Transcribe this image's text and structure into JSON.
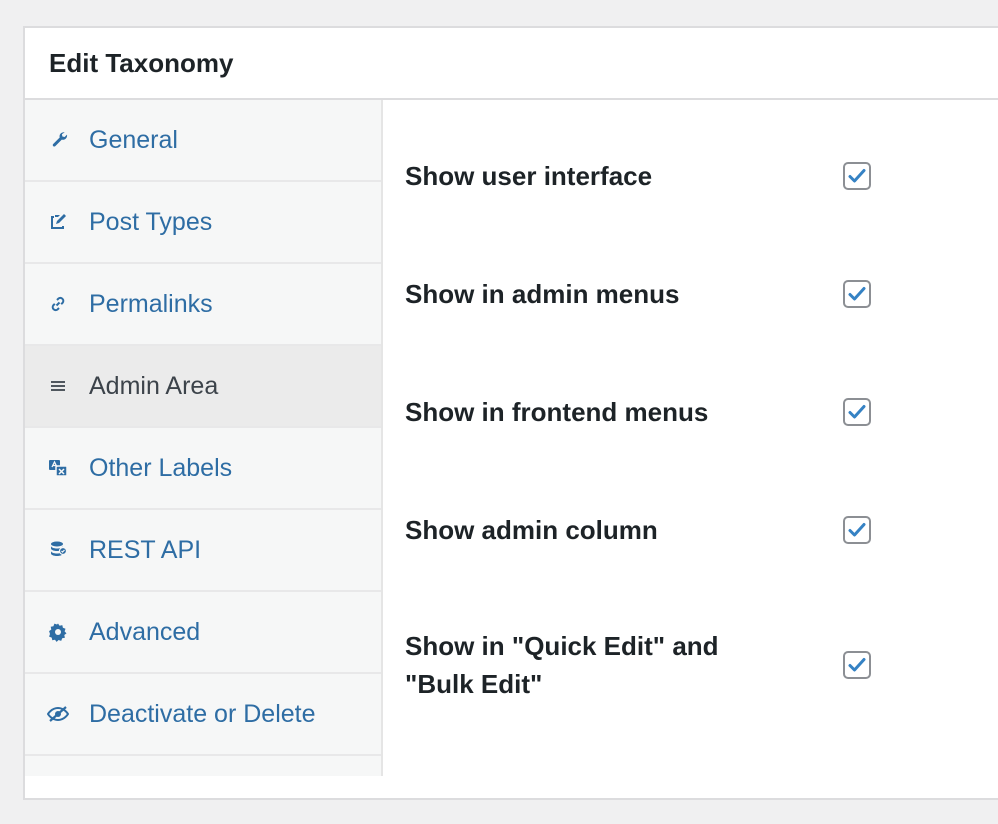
{
  "panel": {
    "title": "Edit Taxonomy"
  },
  "sidebar": {
    "items": [
      {
        "label": "General",
        "icon": "wrench-icon",
        "active": false
      },
      {
        "label": "Post Types",
        "icon": "edit-page-icon",
        "active": false
      },
      {
        "label": "Permalinks",
        "icon": "link-icon",
        "active": false
      },
      {
        "label": "Admin Area",
        "icon": "menu-icon",
        "active": true
      },
      {
        "label": "Other Labels",
        "icon": "translation-icon",
        "active": false
      },
      {
        "label": "REST API",
        "icon": "database-icon",
        "active": false
      },
      {
        "label": "Advanced",
        "icon": "gear-icon",
        "active": false
      },
      {
        "label": "Deactivate or Delete",
        "icon": "hidden-icon",
        "active": false
      }
    ]
  },
  "settings": {
    "rows": [
      {
        "label": "Show user interface",
        "checked": true
      },
      {
        "label": "Show in admin menus",
        "checked": true
      },
      {
        "label": "Show in frontend menus",
        "checked": true
      },
      {
        "label": "Show admin column",
        "checked": true
      },
      {
        "label": "Show in \"Quick Edit\" and \"Bulk Edit\"",
        "checked": true
      }
    ]
  },
  "colors": {
    "link": "#2e6da4",
    "check": "#3582c4",
    "text": "#1d2327"
  }
}
